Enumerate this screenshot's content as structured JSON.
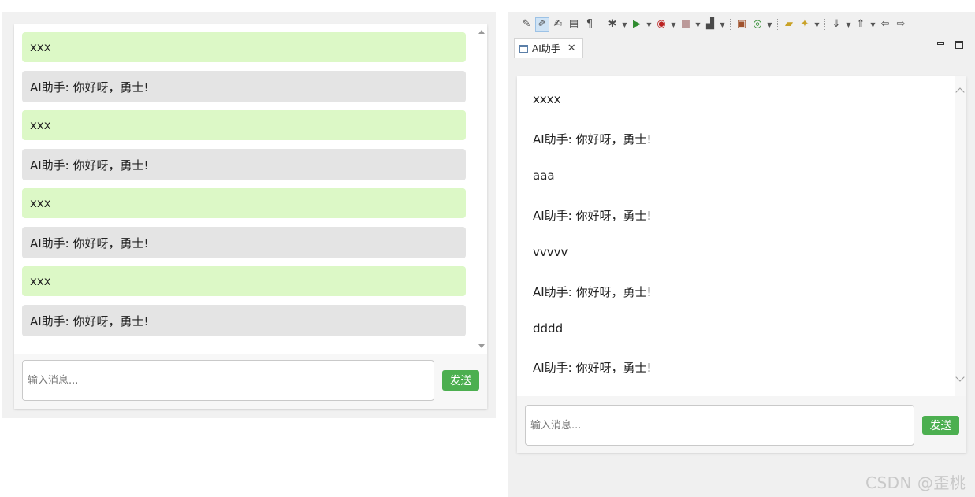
{
  "left_chat": {
    "messages": [
      {
        "role": "user",
        "text": "xxx"
      },
      {
        "role": "ai",
        "text": "AI助手: 你好呀，勇士!"
      },
      {
        "role": "user",
        "text": "xxx"
      },
      {
        "role": "ai",
        "text": "AI助手: 你好呀，勇士!"
      },
      {
        "role": "user",
        "text": "xxx"
      },
      {
        "role": "ai",
        "text": "AI助手: 你好呀，勇士!"
      },
      {
        "role": "user",
        "text": "xxx"
      },
      {
        "role": "ai",
        "text": "AI助手: 你好呀，勇士!"
      }
    ],
    "input_placeholder": "输入消息...",
    "send_label": "发送"
  },
  "ide": {
    "tab_title": "AI助手",
    "chat": {
      "messages": [
        {
          "role": "user",
          "text": "xxxx"
        },
        {
          "role": "ai",
          "text": "AI助手: 你好呀，勇士!"
        },
        {
          "role": "user",
          "text": "aaa"
        },
        {
          "role": "ai",
          "text": "AI助手: 你好呀，勇士!"
        },
        {
          "role": "user",
          "text": "vvvvv"
        },
        {
          "role": "ai",
          "text": "AI助手: 你好呀，勇士!"
        },
        {
          "role": "user",
          "text": "dddd"
        },
        {
          "role": "ai",
          "text": "AI助手: 你好呀，勇士!"
        }
      ],
      "input_placeholder": "输入消息...",
      "send_label": "发送"
    }
  },
  "watermark": "CSDN @歪桃",
  "colors": {
    "user_bubble": "#dcf8c6",
    "ai_bubble": "#e4e4e4",
    "send_button": "#4caf50"
  }
}
